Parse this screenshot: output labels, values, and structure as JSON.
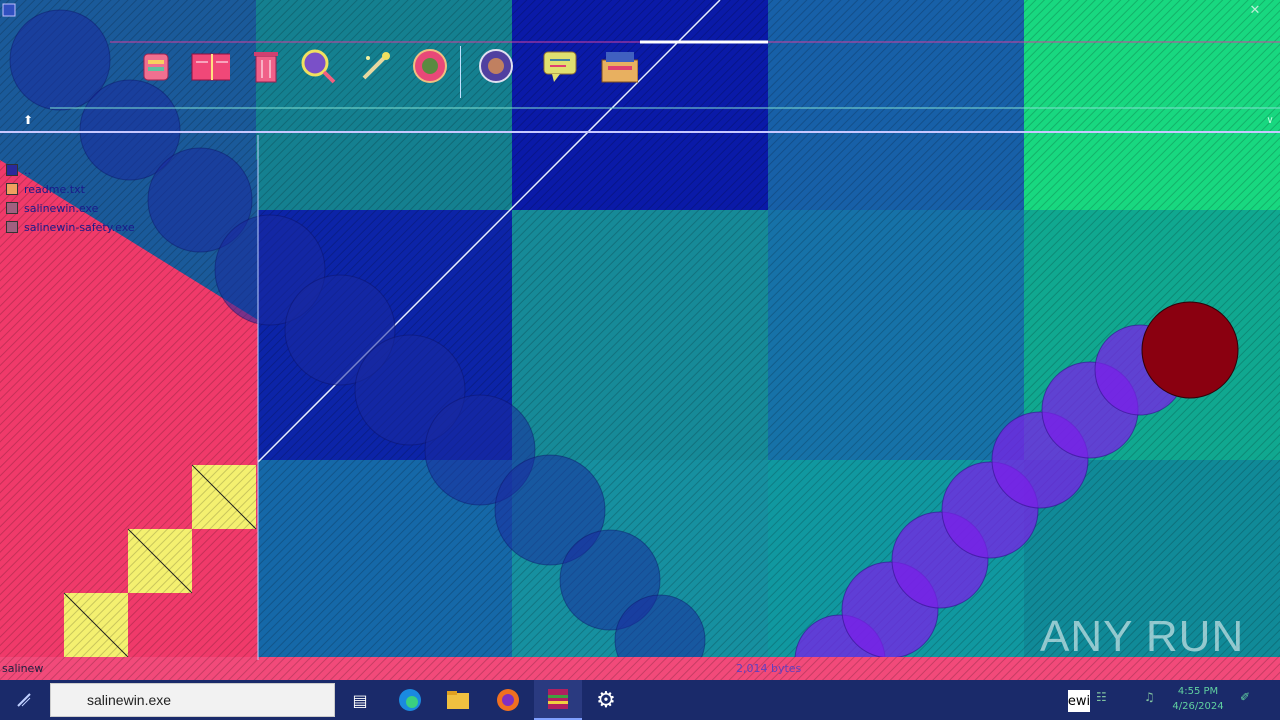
{
  "file_list": {
    "items": [
      {
        "label": ".."
      },
      {
        "label": "readme.txt"
      },
      {
        "label": "salinewin.exe"
      },
      {
        "label": "salinewin-safety.exe"
      }
    ]
  },
  "status_bar": {
    "left_text": "salinew",
    "size_text": "2,014 bytes"
  },
  "taskbar": {
    "search_value": "salinewin.exe",
    "tray_label": "ewi",
    "clock_time": "4:55 PM",
    "clock_date": "4/26/2024"
  },
  "watermark": {
    "text": "ANY RUN"
  },
  "toolbar": {
    "icons": [
      "add-icon",
      "extract-icon",
      "delete-icon",
      "find-icon",
      "wizard-icon",
      "info-icon",
      "virus-scan-icon",
      "comment-icon",
      "sfx-icon"
    ]
  }
}
